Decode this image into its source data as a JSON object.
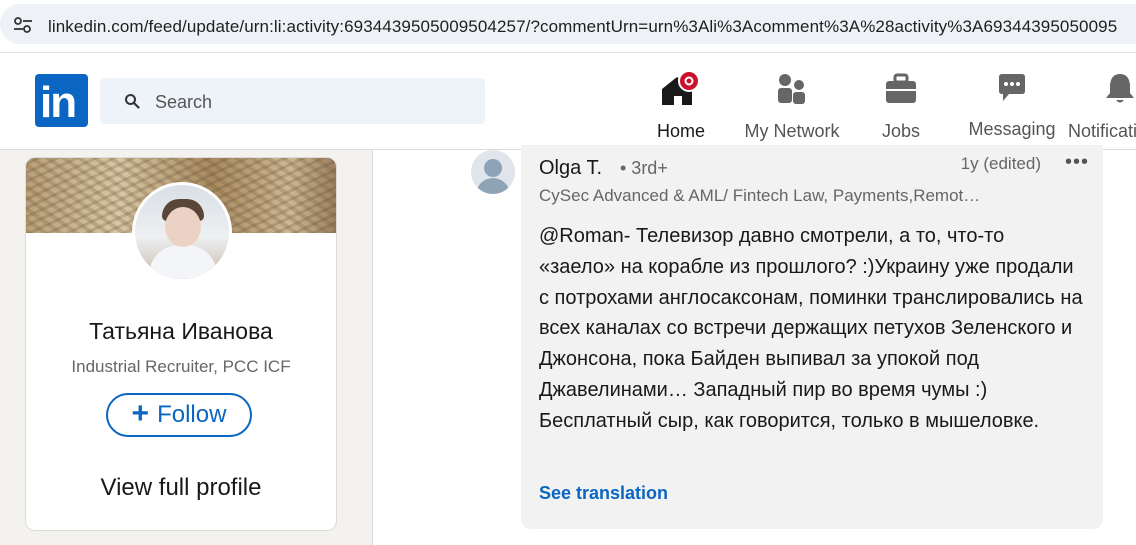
{
  "browser": {
    "url": "linkedin.com/feed/update/urn:li:activity:6934439505009504257/?commentUrn=urn%3Ali%3Acomment%3A%28activity%3A69344395050095"
  },
  "nav": {
    "logo_text": "in",
    "search_placeholder": "Search",
    "items": [
      {
        "label": "Home",
        "icon": "home-icon",
        "active": true
      },
      {
        "label": "My Network",
        "icon": "network-icon"
      },
      {
        "label": "Jobs",
        "icon": "briefcase-icon"
      },
      {
        "label": "Messaging",
        "icon": "messaging-icon"
      },
      {
        "label": "Notifications",
        "icon": "bell-icon"
      }
    ]
  },
  "profile_card": {
    "name": "Татьяна Иванова",
    "headline": "Industrial Recruiter, PCC ICF",
    "follow_label": "Follow",
    "view_profile_label": "View full profile"
  },
  "comment": {
    "author": "Olga T.",
    "degree": "• 3rd+",
    "time": "1y (edited)",
    "more": "•••",
    "headline": "CySec Advanced & AML/ Fintech Law, Payments,Remot…",
    "text": "@Roman- Телевизор давно смотрели, а то, что-то «заело» на корабле из прошлого? :)Украину уже продали с потрохами англосаксонам, поминки транслировались на всех каналах со встречи держащих петухов Зеленского и Джонсона, пока Байден выпивал за упокой под Джавелинами… Западный пир во время чумы :) Бесплатный сыр, как говорится, только в мышеловке.",
    "translate_label": "See translation"
  },
  "colors": {
    "brand": "#0a66c2",
    "notification_dot": "#cb112d",
    "background": "#f4f2ee"
  }
}
